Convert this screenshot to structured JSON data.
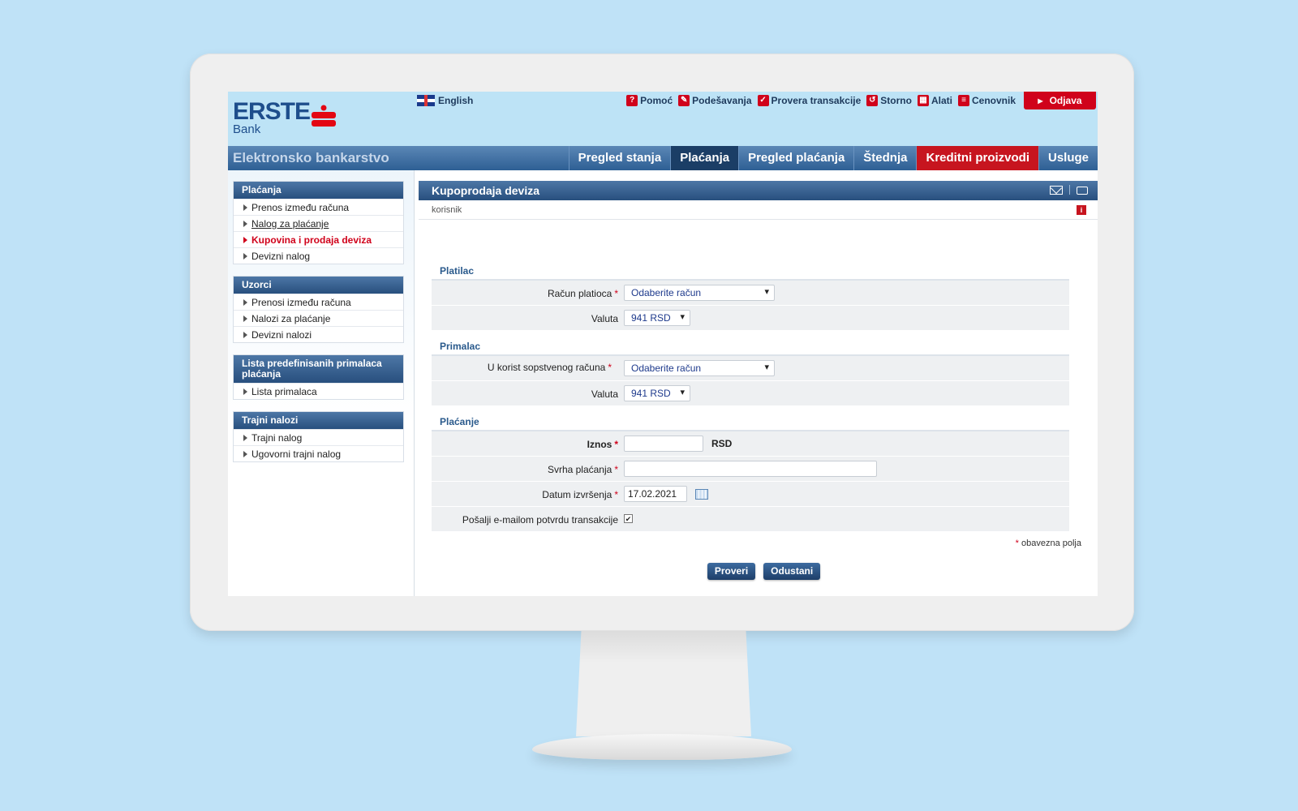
{
  "header": {
    "logo_text": "ERSTE",
    "logo_sub": "Bank",
    "language": "English",
    "utility_links": [
      {
        "label": "Pomoć",
        "icon": "help-icon"
      },
      {
        "label": "Podešavanja",
        "icon": "settings-icon"
      },
      {
        "label": "Provera transakcije",
        "icon": "check-icon"
      },
      {
        "label": "Storno",
        "icon": "storno-icon"
      },
      {
        "label": "Alati",
        "icon": "tools-icon"
      },
      {
        "label": "Cenovnik",
        "icon": "pricelist-icon"
      }
    ],
    "logout_label": "Odjava"
  },
  "nav": {
    "title": "Elektronsko bankarstvo",
    "tabs": [
      {
        "label": "Pregled stanja"
      },
      {
        "label": "Plaćanja"
      },
      {
        "label": "Pregled plaćanja"
      },
      {
        "label": "Štednja"
      },
      {
        "label": "Kreditni proizvodi"
      },
      {
        "label": "Usluge"
      }
    ]
  },
  "sidebar": {
    "groups": [
      {
        "title": "Plaćanja",
        "items": [
          {
            "label": "Prenos između računa"
          },
          {
            "label": "Nalog za plaćanje"
          },
          {
            "label": "Kupovina i prodaja deviza"
          },
          {
            "label": "Devizni nalog"
          }
        ]
      },
      {
        "title": "Uzorci",
        "items": [
          {
            "label": "Prenosi između računa"
          },
          {
            "label": "Nalozi za plaćanje"
          },
          {
            "label": "Devizni nalozi"
          }
        ]
      },
      {
        "title": "Lista predefinisanih primalaca plaćanja",
        "items": [
          {
            "label": "Lista primalaca"
          }
        ]
      },
      {
        "title": "Trajni nalozi",
        "items": [
          {
            "label": "Trajni nalog"
          },
          {
            "label": "Ugovorni trajni nalog"
          }
        ]
      }
    ]
  },
  "main": {
    "title": "Kupoprodaja deviza",
    "user_label": "korisnik",
    "sections": {
      "payer": {
        "title": "Platilac",
        "account_label": "Račun platioca",
        "account_value": "Odaberite račun",
        "currency_label": "Valuta",
        "currency_value": "941 RSD"
      },
      "recipient": {
        "title": "Primalac",
        "account_label": "U korist sopstvenog računa",
        "account_value": "Odaberite račun",
        "currency_label": "Valuta",
        "currency_value": "941 RSD"
      },
      "payment": {
        "title": "Plaćanje",
        "amount_label": "Iznos",
        "amount_unit": "RSD",
        "purpose_label": "Svrha plaćanja",
        "date_label": "Datum izvršenja",
        "date_value": "17.02.2021",
        "email_label": "Pošalji e-mailom potvrdu transakcije",
        "email_checked": true
      }
    },
    "required_mark": "*",
    "mandatory_note": "obavezna polja",
    "buttons": {
      "check": "Proveri",
      "cancel": "Odustani"
    }
  }
}
